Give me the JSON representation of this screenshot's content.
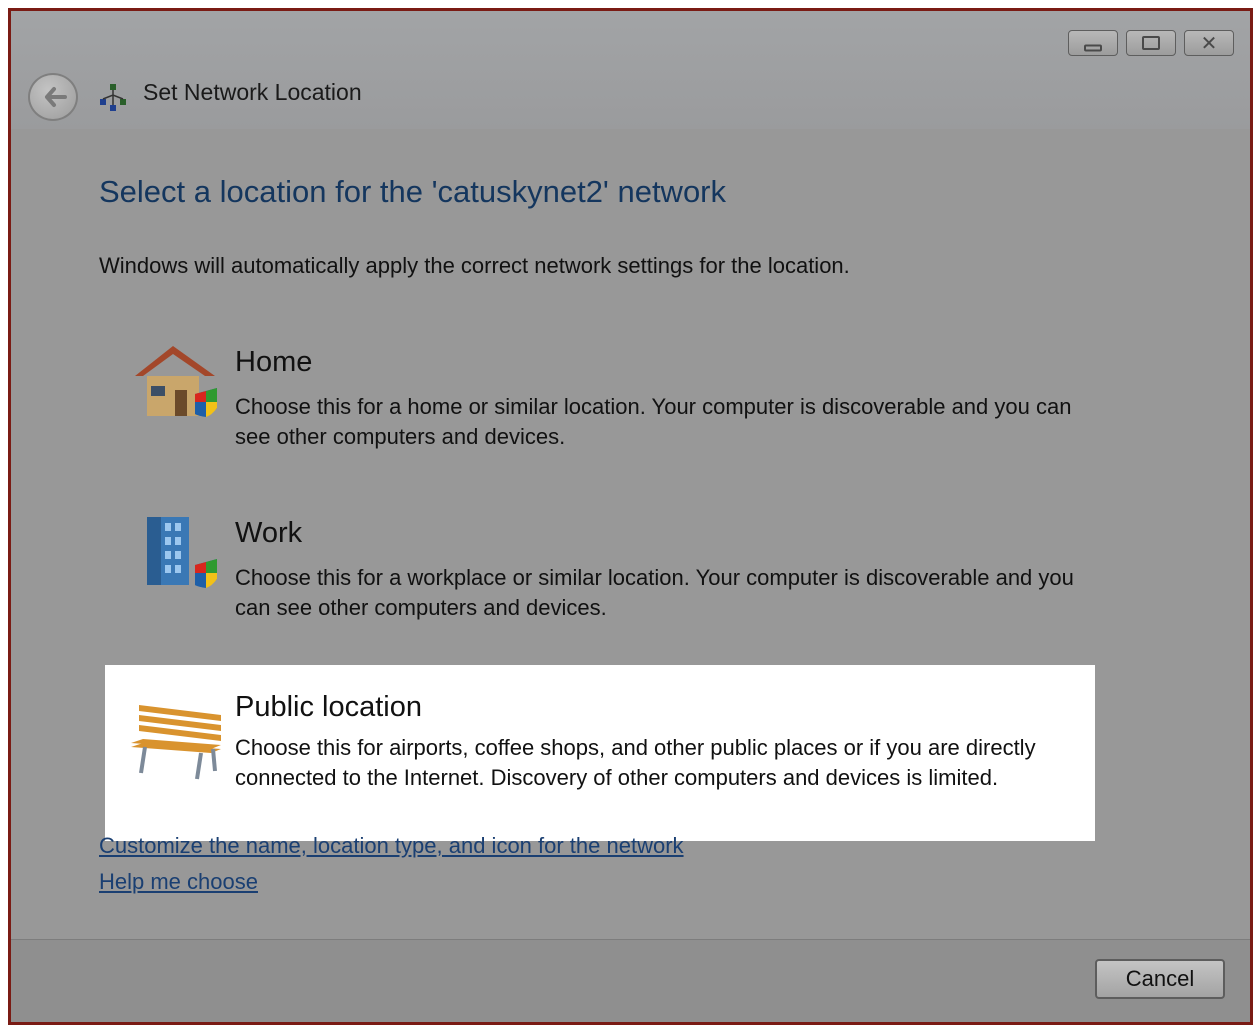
{
  "window": {
    "title": "Set Network Location",
    "caption_icons": [
      "minimize-icon",
      "maximize-icon",
      "close-icon"
    ]
  },
  "main": {
    "heading": "Select a location for the 'catuskynet2' network",
    "intro": "Windows will automatically apply the correct network settings for the location.",
    "options": [
      {
        "title": "Home",
        "description": "Choose this for a home or similar location. Your computer is discoverable and you can see other computers and devices.",
        "icon": "house-icon"
      },
      {
        "title": "Work",
        "description": "Choose this for a workplace or similar location. Your computer is discoverable and you can see other computers and devices.",
        "icon": "office-building-icon"
      },
      {
        "title": "Public location",
        "description": "Choose this for airports, coffee shops, and other public places or if you are directly connected to the Internet. Discovery of other computers and devices is limited.",
        "icon": "park-bench-icon",
        "selected": true
      }
    ],
    "links": [
      "Customize the name, location type, and icon for the network",
      "Help me choose"
    ]
  },
  "footer": {
    "cancel_label": "Cancel"
  },
  "colors": {
    "heading": "#14365e",
    "window_border": "#7a1b14",
    "background": "#989898",
    "selected_background": "#ffffff"
  }
}
